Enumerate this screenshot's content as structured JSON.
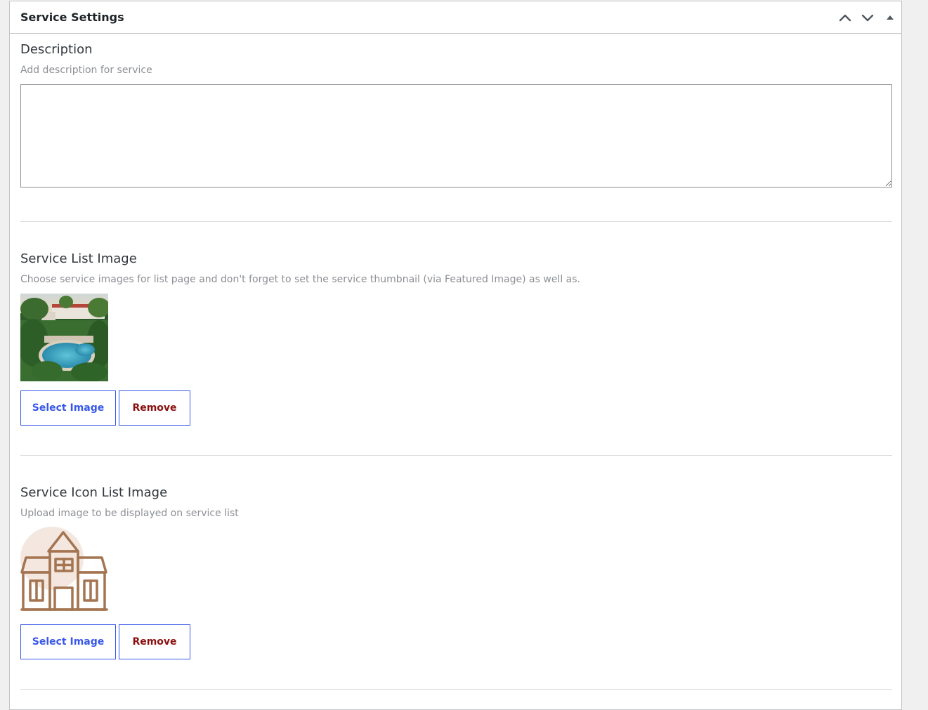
{
  "metabox": {
    "title": "Service Settings",
    "actions": {
      "move_up_icon": "chevron-up-icon",
      "move_down_icon": "chevron-down-icon",
      "toggle_icon": "triangle-up-icon"
    }
  },
  "description": {
    "title": "Description",
    "help": "Add description for service",
    "value": ""
  },
  "service_list_image": {
    "title": "Service List Image",
    "help": "Choose service images for list page and don't forget to set the service thumbnail (via Featured Image) as well as.",
    "image": "resort-pool-photo",
    "select_label": "Select Image",
    "remove_label": "Remove"
  },
  "service_icon_list_image": {
    "title": "Service Icon List Image",
    "help": "Upload image to be displayed on service list",
    "image": "house-icon",
    "select_label": "Select Image",
    "remove_label": "Remove"
  },
  "colors": {
    "button_border": "#3858e9",
    "select_text": "#3858e9",
    "remove_text": "#8a1010",
    "icon_brown": "#a47550"
  }
}
